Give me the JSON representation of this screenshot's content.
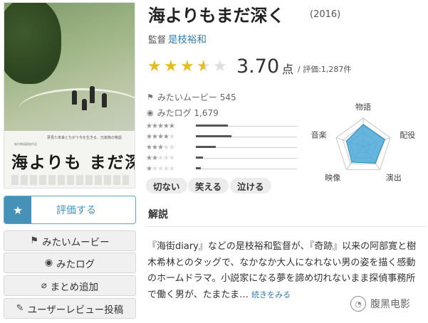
{
  "movie": {
    "title": "海よりもまだ深く",
    "year": "(2016)",
    "director_label": "監督",
    "director_name": "是枝裕和"
  },
  "poster": {
    "tagline": "夢見た未来とちがう今を生きる、元家族の物語",
    "credits_top": "新作映画配給作品",
    "title_art": "海よりも まだ深く"
  },
  "rating": {
    "stars_value": 3.5,
    "stars_max": 5,
    "score": "3.70",
    "unit": "点",
    "count_text": "/ 評価:1,287件",
    "distribution": [
      {
        "stars": 5,
        "fraction": 0.32
      },
      {
        "stars": 4,
        "fraction": 0.35
      },
      {
        "stars": 3,
        "fraction": 0.2
      },
      {
        "stars": 2,
        "fraction": 0.07
      },
      {
        "stars": 1,
        "fraction": 0.05
      }
    ]
  },
  "stats": {
    "mitai_text": "みたいムービー 545",
    "mita_text": "みたログ 1,679"
  },
  "tags": [
    "切ない",
    "笑える",
    "泣ける"
  ],
  "radar": {
    "labels": [
      "物語",
      "配役",
      "演出",
      "映像",
      "音楽"
    ],
    "values": [
      0.78,
      0.8,
      0.72,
      0.68,
      0.62
    ],
    "fill_color": "#4aa8d8"
  },
  "buttons": {
    "rate": "評価する",
    "mitai": "みたいムービー",
    "mita": "みたログ",
    "matome": "まとめ追加",
    "review": "ユーザーレビュー投稿"
  },
  "section": {
    "title": "解説",
    "synopsis": "『海街diary』などの是枝裕和監督が、『奇跡』以来の阿部寛と樹木希林とのタッグで、なかなか大人になれない男の姿を描く感動のホームドラマ。小説家になる夢を諦め切れないまま探偵事務所で働く男が、たまたま…",
    "more": "続きをみる"
  },
  "watermark": {
    "text": "腹黑电影"
  },
  "colors": {
    "accent": "#4591b8",
    "star": "#e4bb23",
    "link": "#3a7ca8"
  },
  "icons": {
    "rate": "star-icon",
    "mitai": "flag-icon",
    "mita": "eye-icon",
    "matome": "paperclip-icon",
    "review": "pencil-icon"
  }
}
